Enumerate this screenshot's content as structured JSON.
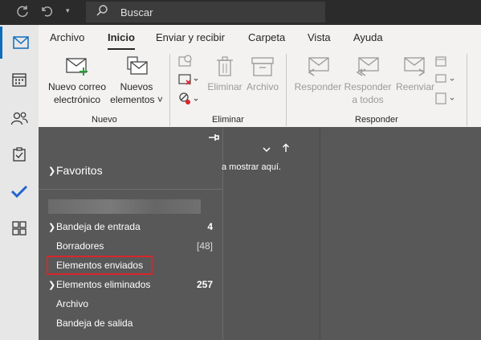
{
  "titlebar": {
    "sync_icon": "refresh-icon",
    "undo_icon": "undo-icon",
    "search_placeholder": "Buscar"
  },
  "leftbar": {
    "items": [
      "mail-icon",
      "calendar-icon",
      "people-icon",
      "tasks-icon",
      "todo-check-icon",
      "apps-icon"
    ],
    "active": "mail-icon"
  },
  "ribbon": {
    "tabs": [
      "Archivo",
      "Inicio",
      "Enviar y recibir",
      "Carpeta",
      "Vista",
      "Ayuda"
    ],
    "active_tab": "Inicio",
    "nuevo": {
      "new_mail_line1": "Nuevo correo",
      "new_mail_line2": "electrónico",
      "new_items_line1": "Nuevos",
      "new_items_line2": "elementos",
      "group": "Nuevo"
    },
    "eliminar": {
      "eliminar": "Eliminar",
      "archivo": "Archivo",
      "group": "Eliminar"
    },
    "responder": {
      "responder": "Responder",
      "responder_todos_line1": "Responder",
      "responder_todos_line2": "a todos",
      "reenviar": "Reenviar",
      "group": "Responder"
    }
  },
  "folders": {
    "favoritos": "Favoritos",
    "items": [
      {
        "label": "Bandeja de entrada",
        "count": "4"
      },
      {
        "label": "Borradores",
        "count": "[48]"
      },
      {
        "label": "Elementos enviados",
        "count": ""
      },
      {
        "label": "Elementos eliminados",
        "count": "257"
      },
      {
        "label": "Archivo",
        "count": ""
      },
      {
        "label": "Bandeja de salida",
        "count": ""
      }
    ]
  },
  "messagelist": {
    "empty_text": "a mostrar aquí."
  },
  "colors": {
    "accent": "#0f6cbd",
    "highlight": "#d9252a"
  }
}
